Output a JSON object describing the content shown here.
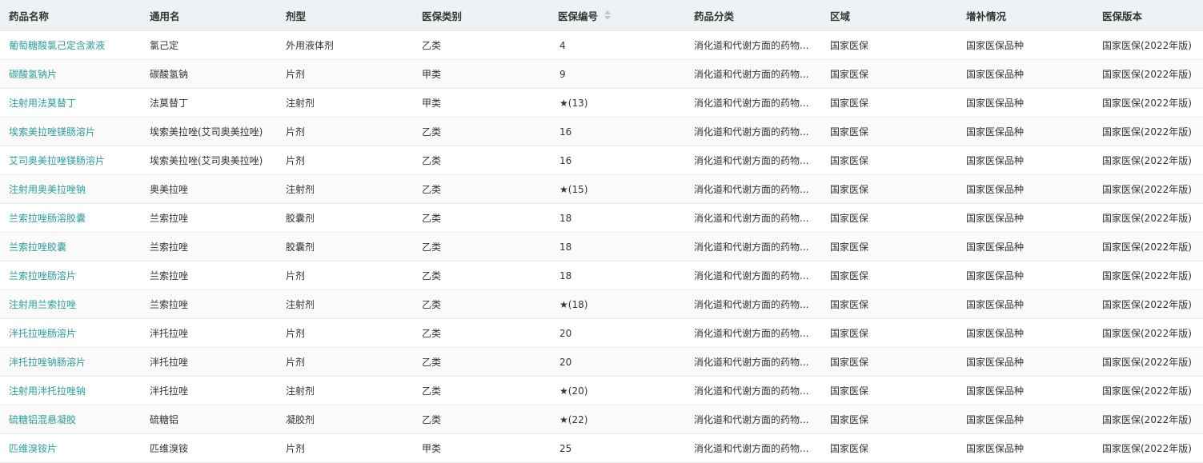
{
  "table": {
    "columns": [
      {
        "label": "药品名称",
        "sortable": false
      },
      {
        "label": "通用名",
        "sortable": false
      },
      {
        "label": "剂型",
        "sortable": false
      },
      {
        "label": "医保类别",
        "sortable": false
      },
      {
        "label": "医保编号",
        "sortable": true
      },
      {
        "label": "药品分类",
        "sortable": false
      },
      {
        "label": "区域",
        "sortable": false
      },
      {
        "label": "增补情况",
        "sortable": false
      },
      {
        "label": "医保版本",
        "sortable": false
      }
    ],
    "rows": [
      [
        "葡萄糖酸氯己定含漱液",
        "氯己定",
        "外用液体剂",
        "乙类",
        "4",
        "消化道和代谢方面的药物...",
        "国家医保",
        "国家医保品种",
        "国家医保(2022年版)"
      ],
      [
        "碳酸氢钠片",
        "碳酸氢钠",
        "片剂",
        "甲类",
        "9",
        "消化道和代谢方面的药物...",
        "国家医保",
        "国家医保品种",
        "国家医保(2022年版)"
      ],
      [
        "注射用法莫替丁",
        "法莫替丁",
        "注射剂",
        "甲类",
        "★(13)",
        "消化道和代谢方面的药物...",
        "国家医保",
        "国家医保品种",
        "国家医保(2022年版)"
      ],
      [
        "埃索美拉唑镁肠溶片",
        "埃索美拉唑(艾司奥美拉唑)",
        "片剂",
        "乙类",
        "16",
        "消化道和代谢方面的药物...",
        "国家医保",
        "国家医保品种",
        "国家医保(2022年版)"
      ],
      [
        "艾司奥美拉唑镁肠溶片",
        "埃索美拉唑(艾司奥美拉唑)",
        "片剂",
        "乙类",
        "16",
        "消化道和代谢方面的药物...",
        "国家医保",
        "国家医保品种",
        "国家医保(2022年版)"
      ],
      [
        "注射用奥美拉唑钠",
        "奥美拉唑",
        "注射剂",
        "乙类",
        "★(15)",
        "消化道和代谢方面的药物...",
        "国家医保",
        "国家医保品种",
        "国家医保(2022年版)"
      ],
      [
        "兰索拉唑肠溶胶囊",
        "兰索拉唑",
        "胶囊剂",
        "乙类",
        "18",
        "消化道和代谢方面的药物...",
        "国家医保",
        "国家医保品种",
        "国家医保(2022年版)"
      ],
      [
        "兰索拉唑胶囊",
        "兰索拉唑",
        "胶囊剂",
        "乙类",
        "18",
        "消化道和代谢方面的药物...",
        "国家医保",
        "国家医保品种",
        "国家医保(2022年版)"
      ],
      [
        "兰索拉唑肠溶片",
        "兰索拉唑",
        "片剂",
        "乙类",
        "18",
        "消化道和代谢方面的药物...",
        "国家医保",
        "国家医保品种",
        "国家医保(2022年版)"
      ],
      [
        "注射用兰索拉唑",
        "兰索拉唑",
        "注射剂",
        "乙类",
        "★(18)",
        "消化道和代谢方面的药物...",
        "国家医保",
        "国家医保品种",
        "国家医保(2022年版)"
      ],
      [
        "泮托拉唑肠溶片",
        "泮托拉唑",
        "片剂",
        "乙类",
        "20",
        "消化道和代谢方面的药物...",
        "国家医保",
        "国家医保品种",
        "国家医保(2022年版)"
      ],
      [
        "泮托拉唑钠肠溶片",
        "泮托拉唑",
        "片剂",
        "乙类",
        "20",
        "消化道和代谢方面的药物...",
        "国家医保",
        "国家医保品种",
        "国家医保(2022年版)"
      ],
      [
        "注射用泮托拉唑钠",
        "泮托拉唑",
        "注射剂",
        "乙类",
        "★(20)",
        "消化道和代谢方面的药物...",
        "国家医保",
        "国家医保品种",
        "国家医保(2022年版)"
      ],
      [
        "硫糖铝混悬凝胶",
        "硫糖铝",
        "凝胶剂",
        "乙类",
        "★(22)",
        "消化道和代谢方面的药物...",
        "国家医保",
        "国家医保品种",
        "国家医保(2022年版)"
      ],
      [
        "匹维溴铵片",
        "匹维溴铵",
        "片剂",
        "甲类",
        "25",
        "消化道和代谢方面的药物...",
        "国家医保",
        "国家医保品种",
        "国家医保(2022年版)"
      ]
    ]
  },
  "icons": {
    "sort": "sort-icon"
  },
  "colors": {
    "header_bg": "#edf3f4",
    "link": "#2a9d98",
    "stripe": "#fafafa"
  }
}
